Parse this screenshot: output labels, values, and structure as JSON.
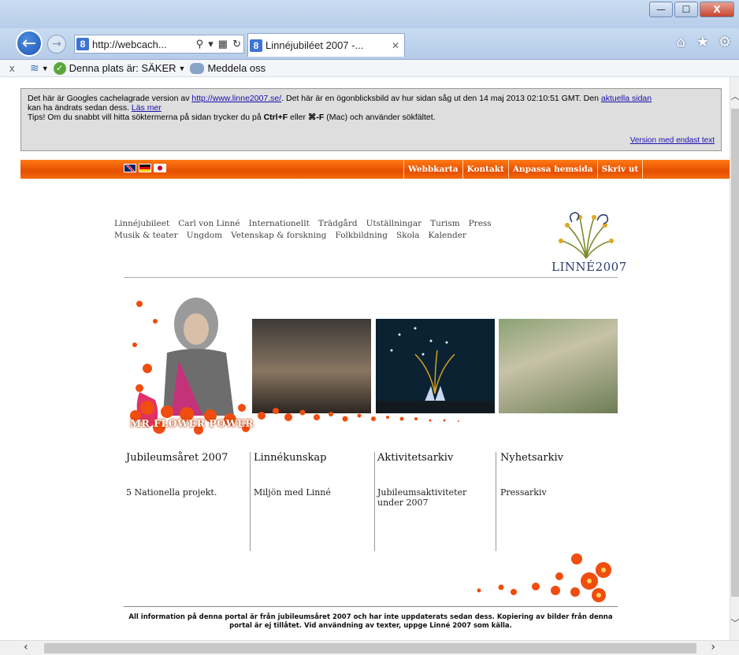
{
  "browser": {
    "window_controls": {
      "minimize": "—",
      "maximize": "☐",
      "close": "X"
    },
    "address": "http://webcach...",
    "tab_title": "Linnéjubiléet 2007 -...",
    "toolbar": {
      "close": "x",
      "site_status": "Denna plats är: SÄKER",
      "report": "Meddela oss"
    }
  },
  "cache_notice": {
    "line1_pre": "Det här är Googles cachelagrade version av ",
    "line1_link": "http://www.linne2007.se/",
    "line1_mid": ". Det här är en ögonblicksbild av hur sidan såg ut den 14 maj 2013 02:10:51 GMT. Den ",
    "line1_link2": "aktuella sidan",
    "line2_pre": "kan ha ändrats sedan dess. ",
    "line2_link": "Läs mer",
    "tips_pre": "Tips! Om du snabbt vill hitta söktermerna på sidan trycker du på ",
    "tips_key1": "Ctrl+F",
    "tips_mid": " eller ",
    "tips_key2": "⌘-F",
    "tips_post": " (Mac) och använder sökfältet.",
    "text_version": "Version med endast text"
  },
  "top_links": [
    "Webbkarta",
    "Kontakt",
    "Anpassa hemsida",
    "Skriv ut"
  ],
  "main_nav": {
    "row1": [
      "Linnéjubileet",
      "Carl von Linné",
      "Internationellt",
      "Trädgård",
      "Utställningar",
      "Turism",
      "Press"
    ],
    "row2": [
      "Musik & teater",
      "Ungdom",
      "Vetenskap & forskning",
      "Folkbildning",
      "Skola",
      "Kalender"
    ]
  },
  "logo_text": "LINNÉ2007",
  "banner_slogan": "MR FLOWER POWER",
  "columns": [
    {
      "heading": "Jubileumsåret 2007",
      "sub": "5 Nationella projekt."
    },
    {
      "heading": "Linnékunskap",
      "sub": "Miljön med Linné"
    },
    {
      "heading": "Aktivitetsarkiv",
      "sub": "Jubileumsaktiviteter under 2007"
    },
    {
      "heading": "Nyhetsarkiv",
      "sub": "Pressarkiv"
    }
  ],
  "footer": "All information på denna portal är från jubileumsåret 2007 och har inte uppdaterats sedan dess. Kopiering av bilder från denna portal är ej tillåtet. Vid användning av texter, uppge Linné 2007 som källa.",
  "colors": {
    "orange_band": "#f0600a",
    "link": "#1a0dab",
    "logo_blue": "#2a3d6c"
  },
  "icons": [
    "back-arrow-icon",
    "forward-arrow-icon",
    "search-icon",
    "refresh-icon",
    "home-icon",
    "star-icon",
    "gear-icon",
    "wifi-icon",
    "shield-check-icon",
    "people-icon"
  ]
}
